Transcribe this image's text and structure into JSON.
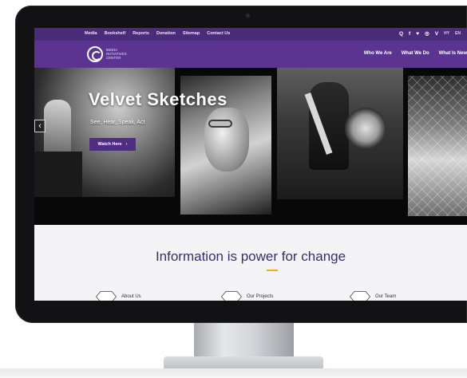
{
  "topbar": {
    "links": [
      "Media",
      "Bookshelf",
      "Reports",
      "Donation",
      "Sitemap",
      "Contact Us"
    ],
    "icons": [
      "search-icon",
      "facebook-icon",
      "twitter-icon",
      "instagram-icon",
      "vimeo-icon"
    ],
    "icon_glyphs": [
      "Q",
      "f",
      "♥",
      "◎",
      "V"
    ],
    "languages": [
      "HY",
      "EN"
    ]
  },
  "mainnav": {
    "logo_lines": [
      "MEDIA",
      "INITIATIVES",
      "CENTER"
    ],
    "links": [
      "Who We Are",
      "What We Do",
      "What Is New"
    ]
  },
  "hero": {
    "title": "Velvet Sketches",
    "subtitle": "See, Hear, Speak, Act",
    "button_label": "Watch Here",
    "button_arrow": "›",
    "prev_arrow": "‹"
  },
  "info": {
    "title": "Information is power for change",
    "features": [
      "About Us",
      "Our Projects",
      "Our Team"
    ]
  },
  "colors": {
    "topbar": "#4a2c7a",
    "nav": "#5a3490",
    "accent": "#f5a623",
    "title": "#3c2b6b"
  }
}
